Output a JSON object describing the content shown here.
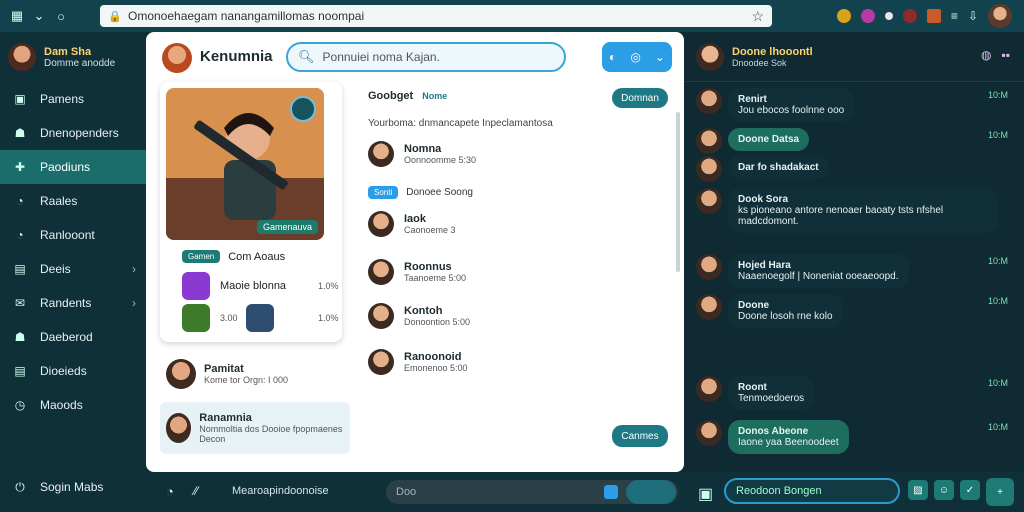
{
  "browser": {
    "url": "Omonoehaegam nanangamillomas noompai",
    "icons": [
      "menu-icon",
      "chevron-down-icon",
      "reload-icon",
      "lock-icon",
      "star-icon"
    ]
  },
  "sidebar": {
    "profile_name": "Dam Sha",
    "profile_sub": "Domme anodde",
    "items": [
      {
        "label": "Pamens",
        "icon": "box-icon"
      },
      {
        "label": "Dnenopenders",
        "icon": "person-icon"
      },
      {
        "label": "Paodiuns",
        "icon": "puzzle-icon",
        "active": true
      },
      {
        "label": "Raales",
        "icon": "chat-icon"
      },
      {
        "label": "Ranlooont",
        "icon": "chat-icon"
      },
      {
        "label": "Deeis",
        "icon": "grid-icon",
        "chevron": true
      },
      {
        "label": "Randents",
        "icon": "mail-icon",
        "chevron": true
      },
      {
        "label": "Daeberod",
        "icon": "person-icon"
      },
      {
        "label": "Dioeieds",
        "icon": "grid-icon"
      },
      {
        "label": "Maoods",
        "icon": "clock-icon"
      }
    ],
    "bottom_label": "Sogin Mabs"
  },
  "center": {
    "title": "Kenumnia",
    "search_placeholder": "Ponnuiei noma Kajan.",
    "card": {
      "tag": "Gamenauva",
      "row1_pill": "Gamen",
      "row1_text": "Com Aoaus",
      "row2_text": "Maoie blonna",
      "row2_meta": "1.0%",
      "row3_meta": "1.0%",
      "row3_sub": "3.00"
    },
    "left_list": [
      {
        "name": "Pamitat",
        "sub": "Kome tor Orgn: I 000"
      },
      {
        "name": "Ranamnia",
        "sub": "Nommoltia dos Dooioe fpopmaenes Decon"
      }
    ],
    "column": {
      "head": "Goobget",
      "head_pill": "Nome",
      "sub": "Yourboma: dnmancapete Inpeclamantosa",
      "button_top": "Domnan",
      "button_bottom": "Canmes",
      "friends": [
        {
          "name": "Nomna",
          "sub": "Oonnoomme 5:30"
        },
        {
          "name": "Donoee Soong",
          "pill": "Sonti",
          "sub": ""
        },
        {
          "name": "Iaok",
          "sub": "Caonoeme 3"
        },
        {
          "name": "Roonnus",
          "sub": "Taanoeme 5:00"
        },
        {
          "name": "Kontoh",
          "sub": "Donoontion 5:00"
        },
        {
          "name": "Ranoonoid",
          "sub": "Emonenoo 5:00"
        }
      ]
    }
  },
  "bottombar": {
    "text": "Mearoapindoonoise",
    "input": "Doo"
  },
  "chat": {
    "title": "Doone lhooontl",
    "sub": "Dnoodee Sok",
    "messages": [
      {
        "name": "Renirt",
        "text": "Jou ebocos foolnne ooo",
        "time": "10:M",
        "green": false
      },
      {
        "name": "Doone Datsa",
        "text": "",
        "time": "10:M",
        "green": true
      },
      {
        "name": "Dar fo shadakact",
        "text": "",
        "time": "",
        "green": false
      },
      {
        "name": "Dook Sora",
        "text": "ks pioneano antore nenoaer baoaty tsts nfshel madcdomont.",
        "time": "",
        "green": false
      },
      {
        "name": "Hojed Hara",
        "text": "Naaenoegolf | Noneniat ooeaeoopd.",
        "time": "10:M",
        "green": false
      },
      {
        "name": "Doone",
        "text": "Doone losoh rne kolo",
        "time": "10:M",
        "green": false
      },
      {
        "name": "Roont",
        "text": "Tenmoedoeros",
        "time": "10:M",
        "green": false
      },
      {
        "name": "Donos Abeone",
        "text": "Iaone yaa Beenoodeet",
        "time": "10:M",
        "green": true
      }
    ],
    "input_placeholder": "Reodoon Bongen"
  }
}
